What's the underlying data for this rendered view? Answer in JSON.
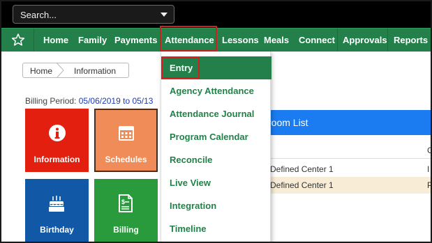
{
  "search": {
    "placeholder": "Search..."
  },
  "nav": {
    "items": [
      {
        "label": "Home"
      },
      {
        "label": "Family"
      },
      {
        "label": "Payments"
      },
      {
        "label": "Attendance"
      },
      {
        "label": "Lessons"
      },
      {
        "label": "Meals"
      },
      {
        "label": "Connect"
      },
      {
        "label": "Approvals"
      },
      {
        "label": "Reports"
      }
    ]
  },
  "breadcrumb": {
    "home": "Home",
    "current": "Information"
  },
  "billing": {
    "label": "Billing Period:",
    "dates": "05/06/2019 to 05/13"
  },
  "tiles": [
    {
      "label": "Information",
      "color": "#e3200f",
      "icon": "info-icon"
    },
    {
      "label": "Schedules",
      "color": "#f08c58",
      "icon": "calendar-icon"
    },
    {
      "label": "Birthday",
      "color": "#1158a7",
      "icon": "cake-icon"
    },
    {
      "label": "Billing",
      "color": "#2a9b3c",
      "icon": "invoice-icon"
    }
  ],
  "classroom": {
    "title": "room List",
    "col_partial": "C",
    "rows": [
      {
        "center": "Defined Center 1",
        "col2": "I"
      },
      {
        "center": "Defined Center 1",
        "col2": "P"
      }
    ]
  },
  "dropdown": {
    "items": [
      {
        "label": "Entry"
      },
      {
        "label": "Agency Attendance"
      },
      {
        "label": "Attendance Journal"
      },
      {
        "label": "Program Calendar"
      },
      {
        "label": "Reconcile"
      },
      {
        "label": "Live View"
      },
      {
        "label": "Integration"
      },
      {
        "label": "Timeline"
      }
    ]
  },
  "colors": {
    "nav": "#24804a",
    "accent_blue": "#1a7cf0",
    "highlight": "#d11f1f"
  }
}
